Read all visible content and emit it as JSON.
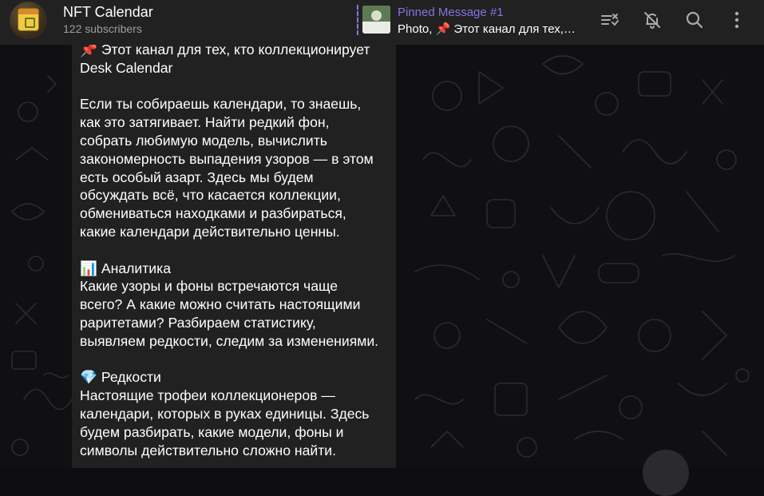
{
  "header": {
    "title": "NFT Calendar",
    "subtitle": "122 subscribers",
    "pinned": {
      "label": "Pinned Message #1",
      "preview": "Photo, 📌 Этот канал для тех, кто коллекционирует Desk Calendar"
    },
    "icons": [
      "list-icon",
      "mute-bell-icon",
      "search-icon",
      "more-vertical-icon"
    ]
  },
  "message": {
    "line1": "Этот канал для тех, кто коллекционирует",
    "line1_emoji": "📌",
    "line2": "Desk Calendar",
    "para1": [
      "Если ты собираешь календари, то знаешь,",
      "как это затягивает. Найти редкий фон,",
      "собрать любимую модель, вычислить",
      "закономерность выпадения узоров — в этом",
      "есть особый азарт. Здесь мы будем",
      "обсуждать всё, что касается коллекции,",
      "обмениваться находками и разбираться,",
      "какие календари действительно ценны."
    ],
    "section1": {
      "emoji": "📊",
      "heading": "Аналитика",
      "lines": [
        "Какие узоры и фоны встречаются чаще",
        "всего? А какие можно считать настоящими",
        "раритетами? Разбираем статистику,",
        "выявляем редкости, следим за изменениями."
      ]
    },
    "section2": {
      "emoji": "💎",
      "heading": "Редкости",
      "lines": [
        "Настоящие трофеи коллекционеров —",
        "календари, которых в руках единицы. Здесь",
        "будем разбирать, какие модели, фоны и",
        "символы действительно сложно найти."
      ]
    }
  },
  "colors": {
    "header_bg": "#212121",
    "accent": "#8774e1",
    "bubble_bg": "#212121",
    "muted_text": "#9e9e9e"
  }
}
